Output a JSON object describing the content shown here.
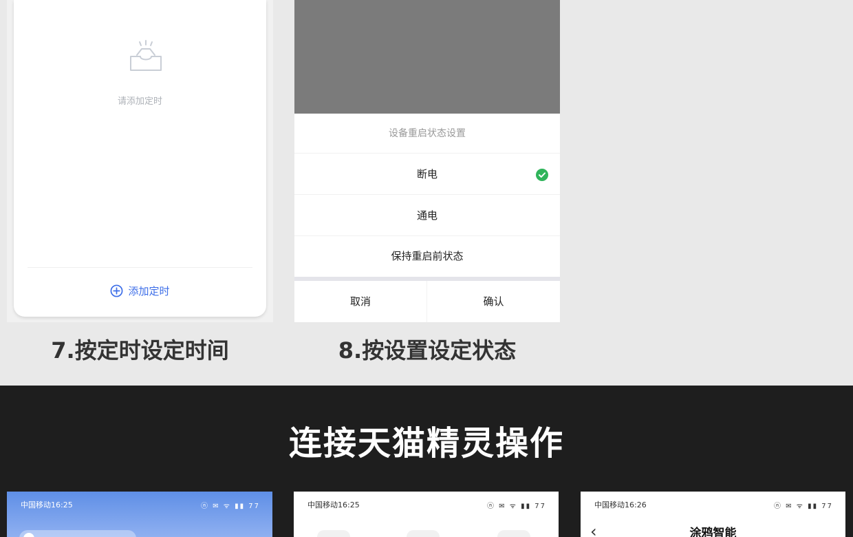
{
  "panel7": {
    "empty_text": "请添加定时",
    "add_label": "添加定时",
    "caption": "7.按定时设定时间"
  },
  "panel8": {
    "sheet_title": "设备重启状态设置",
    "options": [
      {
        "label": "断电",
        "selected": true
      },
      {
        "label": "通电",
        "selected": false
      },
      {
        "label": "保持重启前状态",
        "selected": false
      }
    ],
    "cancel_label": "取消",
    "confirm_label": "确认",
    "caption": "8.按设置设定状态"
  },
  "section": {
    "title": "连接天猫精灵操作"
  },
  "phones": [
    {
      "carrier_time": "中国移动16:25",
      "status_icons": "ⓝ ✉ ᯤ ▮▮ 77"
    },
    {
      "carrier_time": "中国移动16:25",
      "status_icons": "ⓝ ✉ ᯤ ▮▮ 77"
    },
    {
      "carrier_time": "中国移动16:26",
      "status_icons": "ⓝ ✉ ᯤ ▮▮ 77",
      "nav_title": "涂鸦智能"
    }
  ],
  "colors": {
    "accent_blue": "#3d6ee8",
    "check_green": "#2fb45a",
    "dark_bg": "#1e1e1e"
  }
}
